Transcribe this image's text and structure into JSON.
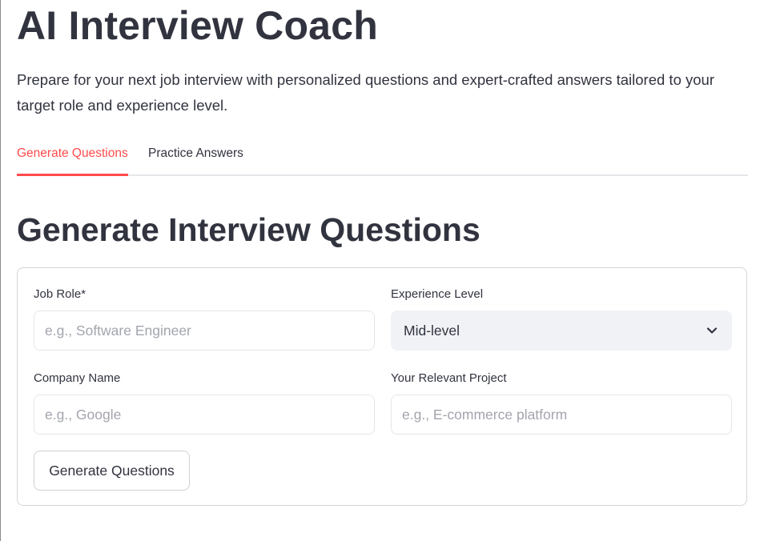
{
  "header": {
    "title": "AI Interview Coach",
    "description": "Prepare for your next job interview with personalized questions and expert-crafted answers tailored to your target role and experience level."
  },
  "tabs": [
    {
      "label": "Generate Questions",
      "active": true
    },
    {
      "label": "Practice Answers",
      "active": false
    }
  ],
  "section": {
    "title": "Generate Interview Questions"
  },
  "form": {
    "job_role": {
      "label": "Job Role*",
      "value": "",
      "placeholder": "e.g., Software Engineer"
    },
    "experience_level": {
      "label": "Experience Level",
      "selected": "Mid-level"
    },
    "company_name": {
      "label": "Company Name",
      "value": "",
      "placeholder": "e.g., Google"
    },
    "relevant_project": {
      "label": "Your Relevant Project",
      "value": "",
      "placeholder": "e.g., E-commerce platform"
    },
    "submit_label": "Generate Questions"
  },
  "colors": {
    "accent": "#ff4b4b",
    "text": "#31333f",
    "placeholder": "#a3a5ad",
    "select_bg": "#f0f2f6",
    "border": "#e6e6ea"
  },
  "icons": {
    "select_chevron": "chevron-down-icon"
  }
}
